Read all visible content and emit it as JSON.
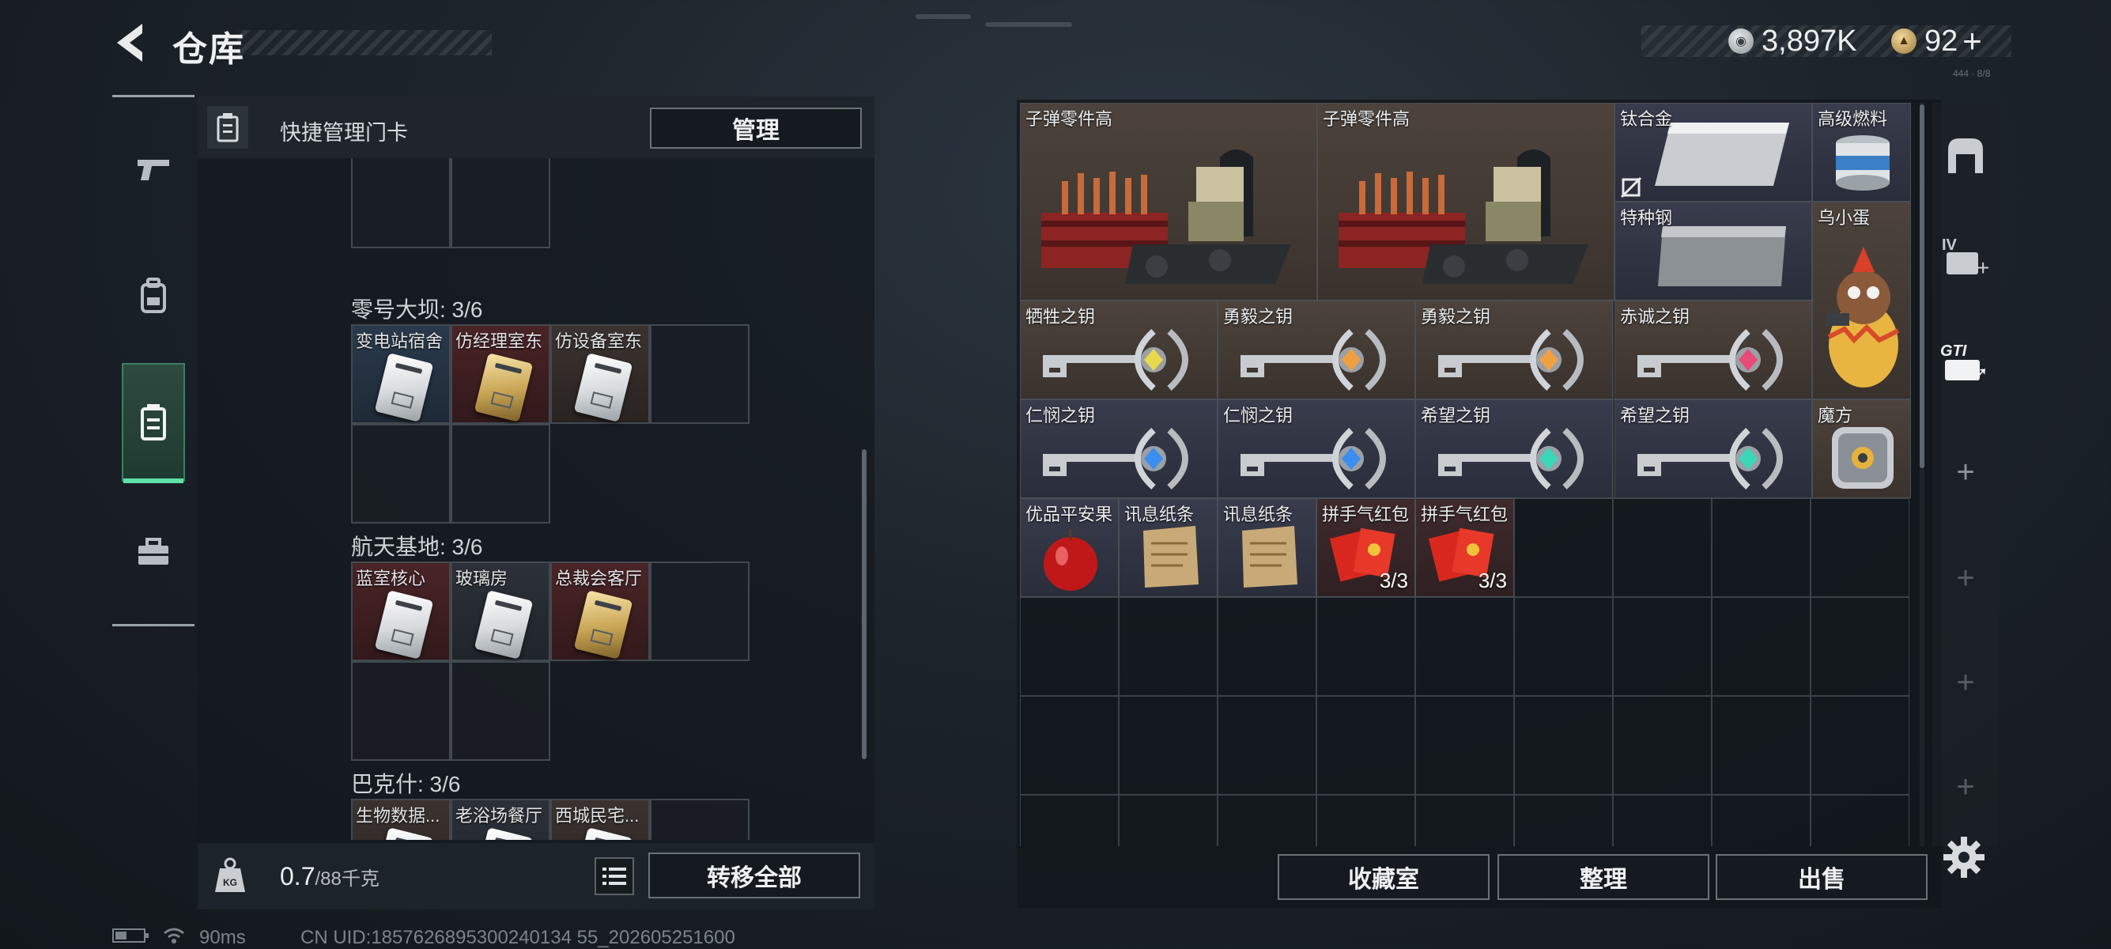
{
  "header": {
    "title": "仓库",
    "currencies": [
      {
        "icon": "silver-coin-icon",
        "value": "3,897K"
      },
      {
        "icon": "gold-coin-icon",
        "value": "92"
      }
    ],
    "add_symbol": "+",
    "tiny_label": "444 · 8/8"
  },
  "left_rail": {
    "tabs": [
      {
        "icon": "pistol-icon",
        "active": false
      },
      {
        "icon": "backpack-icon",
        "active": false
      },
      {
        "icon": "keycard-case-icon",
        "active": true
      },
      {
        "icon": "toolbox-icon",
        "active": false
      }
    ]
  },
  "left_panel": {
    "title": "快捷管理门卡",
    "manage_label": "管理",
    "sections": [
      {
        "title": "零号大坝: 3/6",
        "cards": [
          {
            "label": "变电站宿舍",
            "bg": "blue",
            "gold": false
          },
          {
            "label": "仿经理室东",
            "bg": "red",
            "gold": true
          },
          {
            "label": "仿设备室东",
            "bg": "brown",
            "gold": false
          }
        ]
      },
      {
        "title": "航天基地: 3/6",
        "cards": [
          {
            "label": "蓝室核心",
            "bg": "red",
            "gold": false
          },
          {
            "label": "玻璃房",
            "bg": "gray",
            "gold": false
          },
          {
            "label": "总裁会客厅",
            "bg": "red",
            "gold": true
          }
        ]
      },
      {
        "title": "巴克什: 3/6",
        "cards": [
          {
            "label": "生物数据...",
            "bg": "brown",
            "gold": false
          },
          {
            "label": "老浴场餐厅",
            "bg": "gray",
            "gold": false
          },
          {
            "label": "西城民宅...",
            "bg": "brown",
            "gold": false
          }
        ]
      }
    ],
    "weight_current": "0.7",
    "weight_max": "/88千克",
    "transfer_all_label": "转移全部"
  },
  "right_panel": {
    "items": [
      {
        "label": "子弹零件高",
        "bg": "brown",
        "art": "ammo-crate",
        "count": ""
      },
      {
        "label": "子弹零件高",
        "bg": "brown",
        "art": "ammo-crate",
        "count": ""
      },
      {
        "label": "钛合金",
        "bg": "blue",
        "art": "metal-ingot",
        "count": ""
      },
      {
        "label": "高级燃料",
        "bg": "blue",
        "art": "fuel-can",
        "count": ""
      },
      {
        "label": "特种钢",
        "bg": "blue",
        "art": "metal-ingot",
        "count": ""
      },
      {
        "label": "乌小蛋",
        "bg": "brown",
        "art": "egg-figure",
        "count": ""
      },
      {
        "label": "牺牲之钥",
        "bg": "brown",
        "art": "key",
        "gem": "#e8d84a",
        "count": ""
      },
      {
        "label": "勇毅之钥",
        "bg": "brown",
        "art": "key",
        "gem": "#f0a040",
        "count": ""
      },
      {
        "label": "勇毅之钥",
        "bg": "brown",
        "art": "key",
        "gem": "#f0a040",
        "count": ""
      },
      {
        "label": "赤诚之钥",
        "bg": "brown",
        "art": "key",
        "gem": "#e84a7a",
        "count": ""
      },
      {
        "label": "仁悯之钥",
        "bg": "blue",
        "art": "key",
        "gem": "#3a8ef0",
        "count": ""
      },
      {
        "label": "仁悯之钥",
        "bg": "blue",
        "art": "key",
        "gem": "#3a8ef0",
        "count": ""
      },
      {
        "label": "希望之钥",
        "bg": "blue",
        "art": "key",
        "gem": "#3ad8b8",
        "count": ""
      },
      {
        "label": "希望之钥",
        "bg": "blue",
        "art": "key",
        "gem": "#3ad8b8",
        "count": ""
      },
      {
        "label": "魔方",
        "bg": "brown",
        "art": "cube",
        "count": ""
      },
      {
        "label": "优品平安果",
        "bg": "blue",
        "art": "apple",
        "count": ""
      },
      {
        "label": "讯息纸条",
        "bg": "blue",
        "art": "paper",
        "count": ""
      },
      {
        "label": "讯息纸条",
        "bg": "blue",
        "art": "paper",
        "count": ""
      },
      {
        "label": "拼手气红包",
        "bg": "blue",
        "art": "red-envelope",
        "count": "3/3"
      },
      {
        "label": "拼手气红包",
        "bg": "blue",
        "art": "red-envelope",
        "count": "3/3"
      }
    ],
    "buttons": {
      "collection": "收藏室",
      "sort": "整理",
      "sell": "出售"
    }
  },
  "right_rail": {
    "items": [
      {
        "icon": "safe-box-icon"
      },
      {
        "icon": "expansion-iv-icon",
        "text": "IV"
      },
      {
        "icon": "gti-card-icon",
        "text": "GTI"
      },
      {
        "icon": "plus-icon"
      },
      {
        "icon": "plus-icon"
      },
      {
        "icon": "plus-icon"
      },
      {
        "icon": "plus-icon"
      }
    ]
  },
  "status_bar": {
    "ping": "90ms",
    "uid": "CN UID:1857626895300240134 55_202605251600"
  },
  "colors": {
    "accent": "#5fe0a8",
    "panel": "#141a1f"
  }
}
